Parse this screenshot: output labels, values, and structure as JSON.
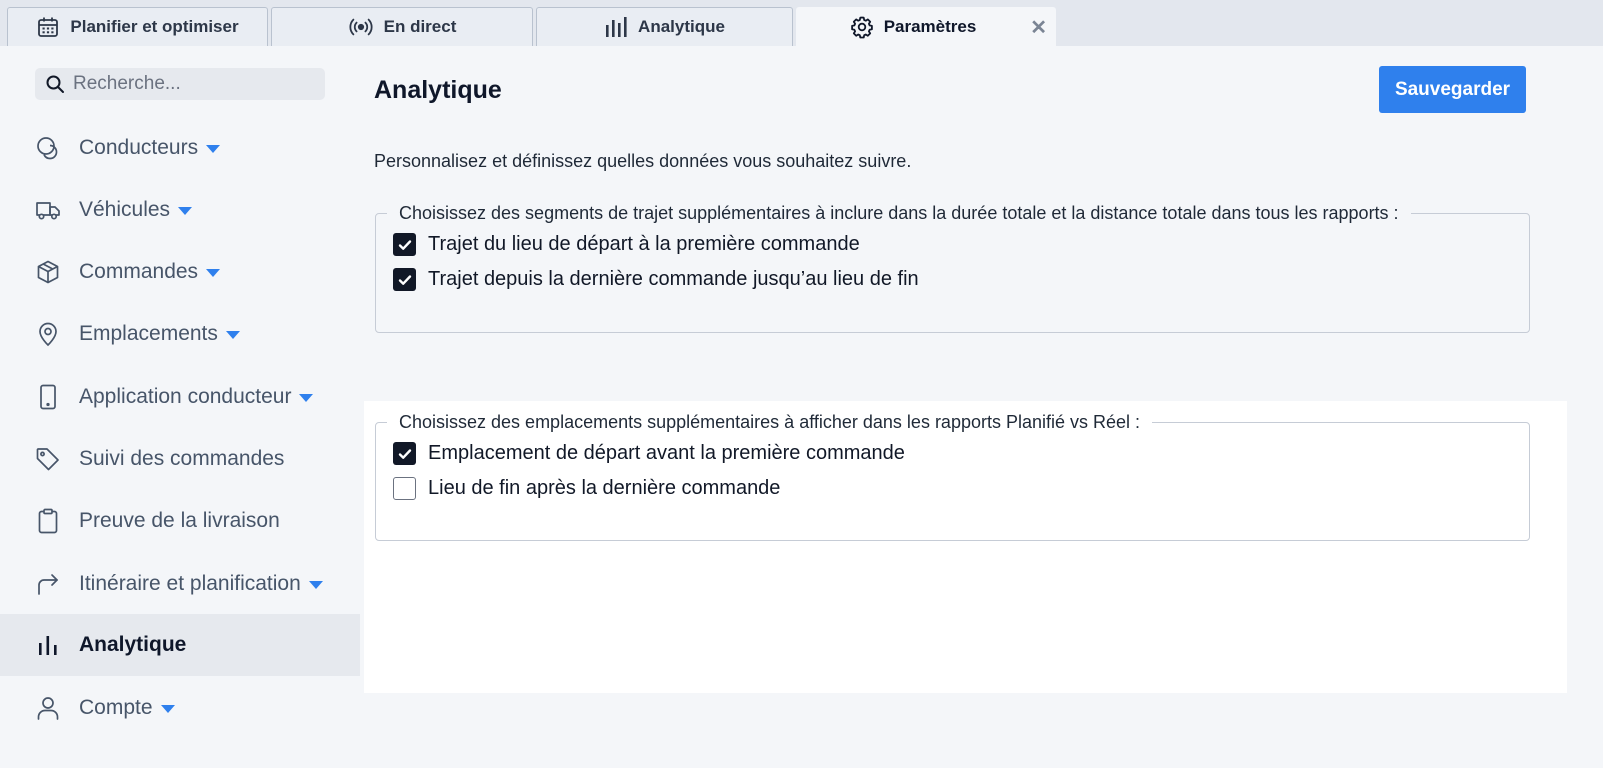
{
  "tabs": [
    {
      "label": "Planifier et optimiser",
      "icon": "calendar-icon"
    },
    {
      "label": "En direct",
      "icon": "broadcast-icon"
    },
    {
      "label": "Analytique",
      "icon": "bar-chart-icon"
    },
    {
      "label": "Paramètres",
      "icon": "gear-icon",
      "active": true
    }
  ],
  "tab_close_symbol": "✕",
  "sidebar": {
    "search_placeholder": "Recherche...",
    "items": [
      {
        "label": "Conducteurs",
        "icon": "drivers-icon",
        "has_dropdown": true
      },
      {
        "label": "Véhicules",
        "icon": "truck-icon",
        "has_dropdown": true
      },
      {
        "label": "Commandes",
        "icon": "box-icon",
        "has_dropdown": true
      },
      {
        "label": "Emplacements",
        "icon": "location-pin-icon",
        "has_dropdown": true
      },
      {
        "label": "Application conducteur",
        "icon": "mobile-phone-icon",
        "has_dropdown": true
      },
      {
        "label": "Suivi des commandes",
        "icon": "tag-icon",
        "has_dropdown": false
      },
      {
        "label": "Preuve de la livraison",
        "icon": "clipboard-icon",
        "has_dropdown": false
      },
      {
        "label": "Itinéraire et planification",
        "icon": "route-arrow-icon",
        "has_dropdown": true
      },
      {
        "label": "Analytique",
        "icon": "bar-chart-icon",
        "has_dropdown": false,
        "active": true
      },
      {
        "label": "Compte",
        "icon": "user-icon",
        "has_dropdown": true
      }
    ]
  },
  "main": {
    "title": "Analytique",
    "save_label": "Sauvegarder",
    "intro": "Personnalisez et définissez quelles données vous souhaitez suivre.",
    "groups": [
      {
        "legend": "Choisissez des segments de trajet supplémentaires à inclure dans la durée totale et la distance totale dans tous les rapports :",
        "options": [
          {
            "label": "Trajet du lieu de départ à la première commande",
            "checked": true
          },
          {
            "label": "Trajet depuis la dernière commande jusqu’au lieu de fin",
            "checked": true
          }
        ]
      },
      {
        "legend": "Choisissez des emplacements supplémentaires à afficher dans les rapports Planifié vs Réel :",
        "options": [
          {
            "label": "Emplacement de départ avant la première commande",
            "checked": true
          },
          {
            "label": "Lieu de fin après la dernière commande",
            "checked": false
          }
        ]
      }
    ]
  },
  "colors": {
    "accent": "#2f80ed",
    "checkbox_checked": "#111827",
    "sidebar_bg": "#f4f6f9",
    "active_item_bg": "#e6e9ee"
  }
}
